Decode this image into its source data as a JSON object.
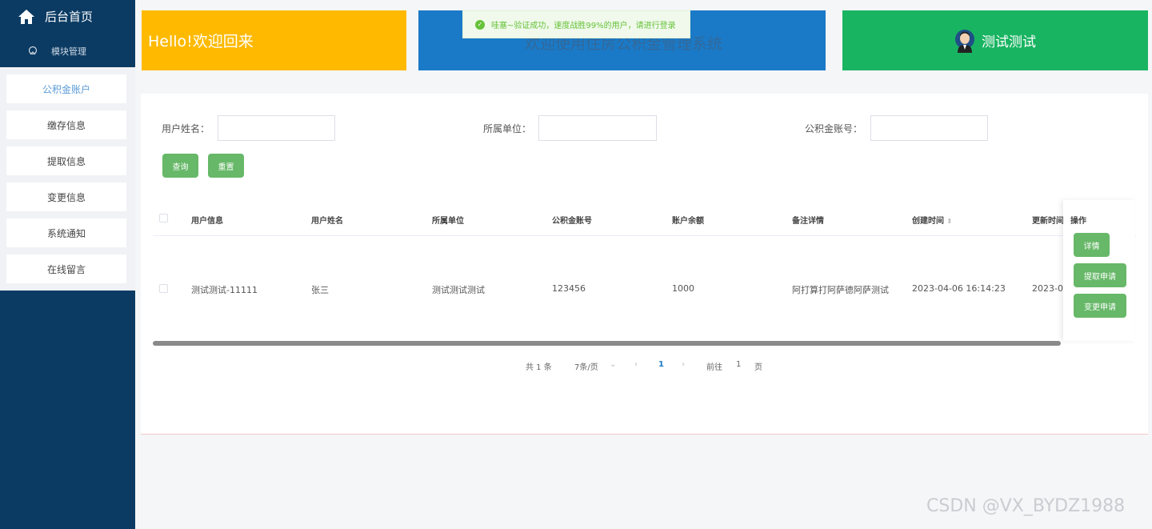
{
  "sidebar": {
    "home_label": "后台首页",
    "module_label": "模块管理",
    "items": [
      {
        "label": "公积金账户",
        "active": true
      },
      {
        "label": "缴存信息",
        "active": false
      },
      {
        "label": "提取信息",
        "active": false
      },
      {
        "label": "变更信息",
        "active": false
      },
      {
        "label": "系统通知",
        "active": false
      },
      {
        "label": "在线留言",
        "active": false
      }
    ]
  },
  "cards": {
    "welcome": "Hello!欢迎回来",
    "system": "欢迎使用住房公积金管理系统",
    "user": "测试测试"
  },
  "toast": {
    "message": "哇塞~验证成功，速度战胜99%的用户，请进行登录"
  },
  "filters": {
    "name_label": "用户姓名：",
    "unit_label": "所属单位：",
    "account_label": "公积金账号：",
    "search_button": "查询",
    "reset_button": "重置"
  },
  "table": {
    "headers": {
      "user_info": "用户信息",
      "user_name": "用户姓名",
      "unit": "所属单位",
      "account": "公积金账号",
      "balance": "账户余额",
      "remark": "备注详情",
      "created": "创建时间",
      "updated": "更新时间",
      "ops": "操作"
    },
    "rows": [
      {
        "user_info": "测试测试-11111",
        "user_name": "张三",
        "unit": "测试测试测试",
        "account": "123456",
        "balance": "1000",
        "remark": "阿打算打阿萨德阿萨测试",
        "created": "2023-04-06 16:14:23",
        "updated": "2023-0"
      }
    ],
    "op_buttons": {
      "detail": "详情",
      "withdraw": "提取申请",
      "change": "变更申请"
    }
  },
  "pagination": {
    "total": "共 1 条",
    "page_size": "7条/页",
    "current_page": "1",
    "goto_label": "前往",
    "goto_value": "1",
    "page_unit": "页"
  },
  "watermark": "CSDN @VX_BYDZ1988",
  "colors": {
    "sidebar": "#0b3b63",
    "yellow": "#ffba00",
    "blue": "#1a7ac7",
    "green": "#19b461",
    "button": "#67b868"
  }
}
